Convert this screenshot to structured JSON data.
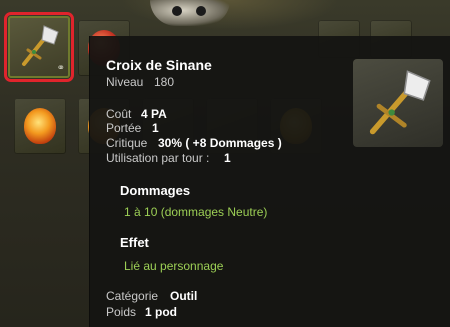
{
  "item": {
    "name": "Croix de Sinane",
    "level_label": "Niveau",
    "level": "180",
    "link_glyph": "⚭"
  },
  "stats": {
    "cost_label": "Coût",
    "cost_value": "4 PA",
    "range_label": "Portée",
    "range_value": "1",
    "crit_label": "Critique",
    "crit_value": "30% ( +8 Dommages )",
    "uses_label": "Utilisation par tour :",
    "uses_value": "1"
  },
  "damage": {
    "heading": "Dommages",
    "line": "1 à 10 (dommages Neutre)"
  },
  "effect": {
    "heading": "Effet",
    "line": "Lié au personnage"
  },
  "footer": {
    "category_label": "Catégorie",
    "category_value": "Outil",
    "weight_label": "Poids",
    "weight_value": "1 pod"
  },
  "colors": {
    "selection_outline": "#e0242c",
    "effect_text": "#9ccf55",
    "tooltip_bg": "#141412"
  },
  "icons": [
    "shovel-cross-icon",
    "fire-orb-icon",
    "amber-egg-icon",
    "link-icon"
  ]
}
